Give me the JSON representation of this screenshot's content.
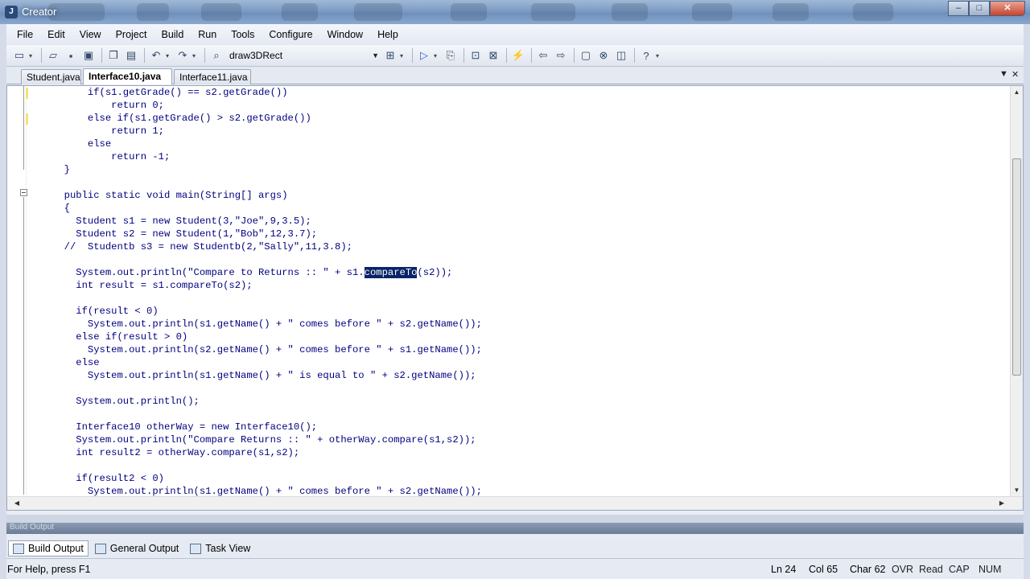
{
  "window": {
    "title": "Creator",
    "controls": {
      "minimize": "–",
      "maximize": "□",
      "close": "✕"
    }
  },
  "menu": [
    "File",
    "Edit",
    "View",
    "Project",
    "Build",
    "Run",
    "Tools",
    "Configure",
    "Window",
    "Help"
  ],
  "toolbar": {
    "target": "draw3DRect"
  },
  "tabs": [
    {
      "label": "Student.java",
      "active": false
    },
    {
      "label": "Interface10.java *",
      "active": true
    },
    {
      "label": "Interface11.java",
      "active": false
    }
  ],
  "editor": {
    "code_lines": [
      "      if(s1.getGrade() == s2.getGrade())",
      "          return 0;",
      "      else if(s1.getGrade() > s2.getGrade())",
      "          return 1;",
      "      else",
      "          return -1;",
      "  }",
      "",
      "  public static void main(String[] args)",
      "  {",
      "    Student s1 = new Student(3,\"Joe\",9,3.5);",
      "    Student s2 = new Student(1,\"Bob\",12,3.7);",
      "  //  Studentb s3 = new Studentb(2,\"Sally\",11,3.8);",
      "",
      "    System.out.println(\"Compare to Returns :: \" + s1.",
      "    int result = s1.compareTo(s2);",
      "",
      "    if(result < 0)",
      "      System.out.println(s1.getName() + \" comes before \" + s2.getName());",
      "    else if(result > 0)",
      "      System.out.println(s2.getName() + \" comes before \" + s1.getName());",
      "    else",
      "      System.out.println(s1.getName() + \" is equal to \" + s2.getName());",
      "",
      "    System.out.println();",
      "",
      "    Interface10 otherWay = new Interface10();",
      "    System.out.println(\"Compare Returns :: \" + otherWay.compare(s1,s2));",
      "    int result2 = otherWay.compare(s1,s2);",
      "",
      "    if(result2 < 0)",
      "      System.out.println(s1.getName() + \" comes before \" + s2.getName());"
    ],
    "selected_text": "compareTo",
    "after_selection": "(s2));"
  },
  "output_panel": {
    "title": "Build Output",
    "tabs": [
      {
        "label": "Build Output",
        "active": true
      },
      {
        "label": "General Output",
        "active": false
      },
      {
        "label": "Task View",
        "active": false
      }
    ]
  },
  "status": {
    "help": "For Help, press F1",
    "ln": "Ln 24",
    "col": "Col 65",
    "char": "Char 62",
    "ovr": "OVR",
    "read": "Read",
    "cap": "CAP",
    "num": "NUM"
  },
  "colors": {
    "code_text": "#000080",
    "selection": "#0a246a",
    "change_marker": "#f2e27a"
  }
}
